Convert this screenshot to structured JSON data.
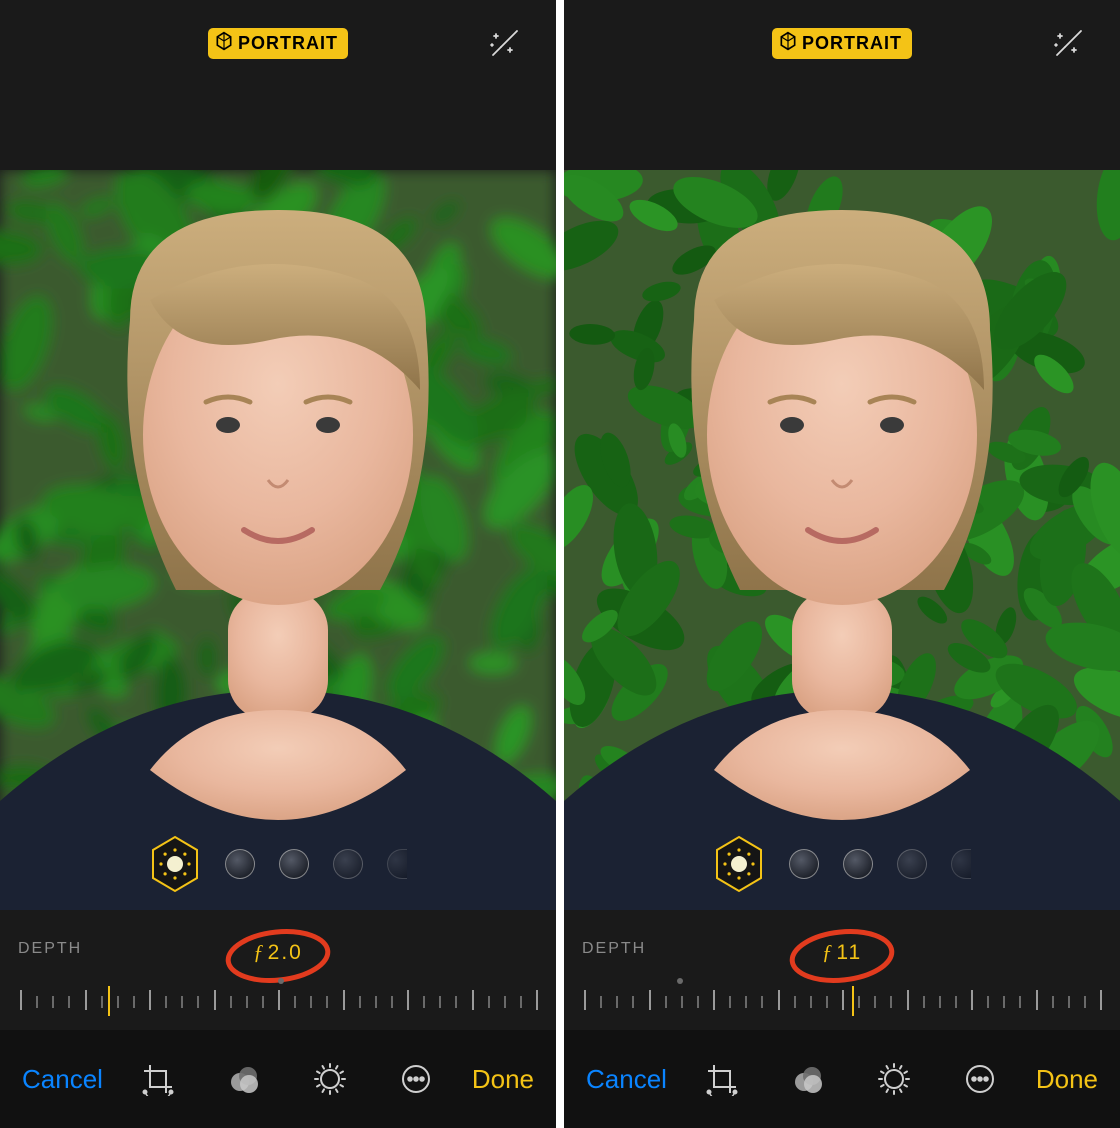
{
  "panels": [
    {
      "mode_badge": "PORTRAIT",
      "depth_label": "DEPTH",
      "f_value": "2.0",
      "pointer_pct": 17,
      "ruler_dot_pct": 50,
      "blur": 7,
      "cancel": "Cancel",
      "done": "Done"
    },
    {
      "mode_badge": "PORTRAIT",
      "depth_label": "DEPTH",
      "f_value": "11",
      "pointer_pct": 52,
      "ruler_dot_pct": 18,
      "blur": 0,
      "cancel": "Cancel",
      "done": "Done"
    }
  ]
}
